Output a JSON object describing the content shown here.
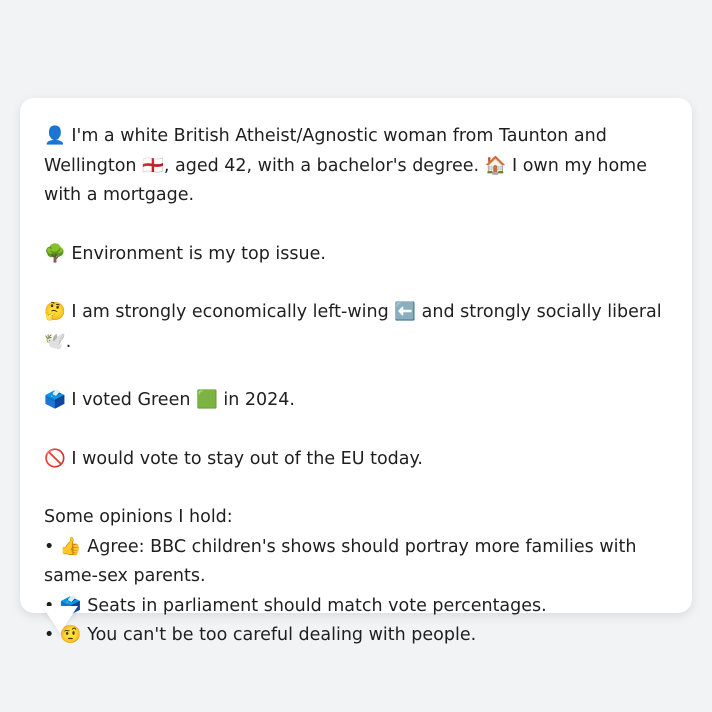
{
  "message": {
    "intro_line1": "👤 I'm a white British Atheist/Agnostic woman from Taunton and Wellington",
    "intro_line2": "🏴󠁧󠁢󠁥󠁮󠁧󠁿, aged 42, with a bachelor's degree. 🏠 I own my home with a mortgage.",
    "top_issue": "🌳 Environment is my top issue.",
    "political_position": "🤔 I am strongly economically left-wing ⬅️ and strongly socially liberal 🕊️.",
    "vote_2024": "🗳️ I voted Green 🟩 in 2024.",
    "eu_stance": "🚫 I would vote to stay out of the EU today.",
    "opinions_heading": "Some opinions I hold:",
    "opinions": [
      "• 👍 Agree: BBC children's shows should portray more families with same-sex parents.",
      "• 🗳️ Seats in parliament should match vote percentages.",
      "• 🤨 You can't be too careful dealing with people."
    ]
  }
}
